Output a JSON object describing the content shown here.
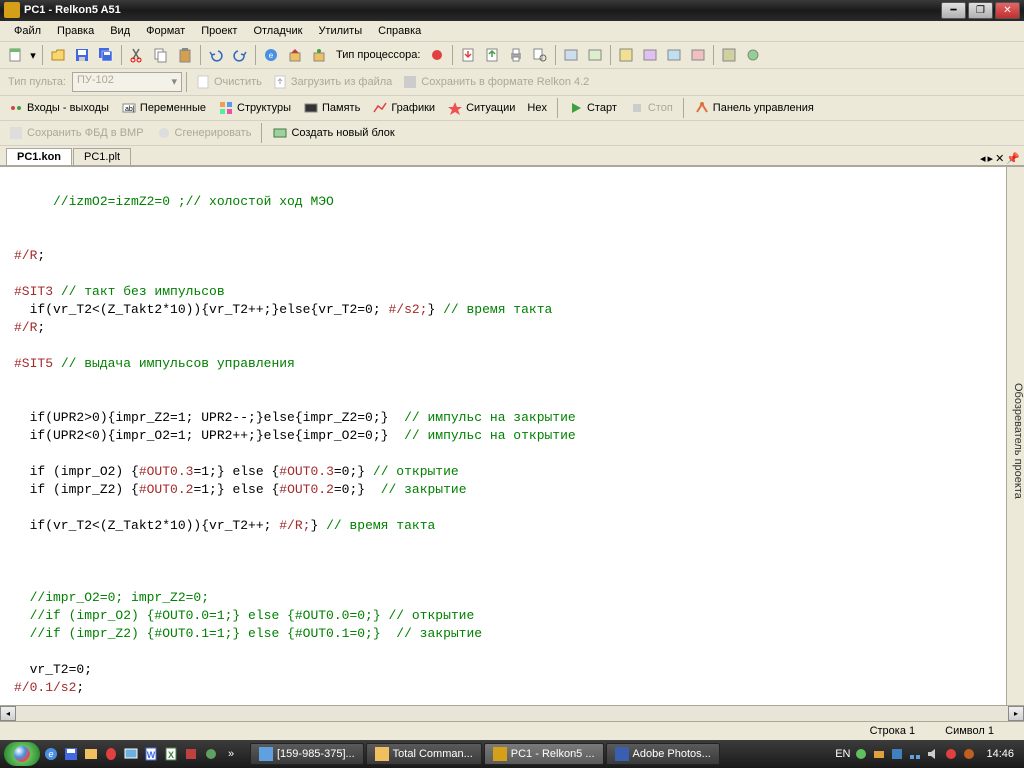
{
  "title": "PC1 - Relkon5 A51",
  "menu": [
    "Файл",
    "Правка",
    "Вид",
    "Формат",
    "Проект",
    "Отладчик",
    "Утилиты",
    "Справка"
  ],
  "toolbar1": {
    "cpu_label": "Тип процессора:"
  },
  "toolbar2": {
    "panel_type_label": "Тип пульта:",
    "panel_type_value": "ПУ-102",
    "clear": "Очистить",
    "load_from_file": "Загрузить из файла",
    "save_relkon": "Сохранить в формате Relkon 4.2"
  },
  "toolbar3": {
    "io": "Входы - выходы",
    "vars": "Переменные",
    "structs": "Структуры",
    "memory": "Память",
    "graphs": "Графики",
    "situations": "Ситуации",
    "hex": "Hex",
    "start": "Старт",
    "stop": "Стоп",
    "control_panel": "Панель управления"
  },
  "toolbar4": {
    "save_fbd": "Сохранить ФБД в BMP",
    "generate": "Сгенерировать",
    "new_block": "Создать новый блок"
  },
  "tabs": {
    "tab1": "PC1.kon",
    "tab2": "PC1.plt"
  },
  "side_panel": "Обозреватель проекта",
  "code": {
    "l1a": "     //izmO2=izmZ2=0 ;// холостой ход МЭО",
    "l2": "#/R",
    "l2s": ";",
    "l3": "#SIT3",
    "l3c": " // такт без импульсов",
    "l4a": "  if(vr_T2<(Z_Takt2*10)){vr_T2++;}else{vr_T2=0; ",
    "l4d": "#/s2;",
    "l4b": "} ",
    "l4c": "// время такта",
    "l5": "#/R",
    "l5s": ";",
    "l6": "#SIT5",
    "l6c": " // выдача импульсов управления",
    "l7a": "  if(UPR2>0){impr_Z2=1; UPR2--;}else{impr_Z2=0;}  ",
    "l7c": "// импульс на закрытие",
    "l8a": "  if(UPR2<0){impr_O2=1; UPR2++;}else{impr_O2=0;}  ",
    "l8c": "// импульс на открытие",
    "l9a": "  if (impr_O2) {",
    "l9d1": "#OUT0.3",
    "l9b": "=1;} else {",
    "l9d2": "#OUT0.3",
    "l9e": "=0;} ",
    "l9c": "// открытие",
    "l10a": "  if (impr_Z2) {",
    "l10d1": "#OUT0.2",
    "l10b": "=1;} else {",
    "l10d2": "#OUT0.2",
    "l10e": "=0;}  ",
    "l10c": "// закрытие",
    "l11a": "  if(vr_T2<(Z_Takt2*10)){vr_T2++; ",
    "l11d": "#/R;",
    "l11b": "} ",
    "l11c": "// время такта",
    "l12": "  //impr_O2=0; impr_Z2=0;",
    "l13": "  //if (impr_O2) {#OUT0.0=1;} else {#OUT0.0=0;} // открытие",
    "l14": "  //if (impr_Z2) {#OUT0.1=1;} else {#OUT0.1=0;}  // закрытие",
    "l15": "  vr_T2=0;",
    "l16": "#/0.1/s2",
    "l16s": ";"
  },
  "status": {
    "line": "Строка 1",
    "col": "Символ 1"
  },
  "taskbar": {
    "items": [
      "[159-985-375]...",
      "Total Comman...",
      "PC1 - Relkon5 ...",
      "Adobe Photos..."
    ],
    "lang": "EN",
    "time": "14:46"
  }
}
